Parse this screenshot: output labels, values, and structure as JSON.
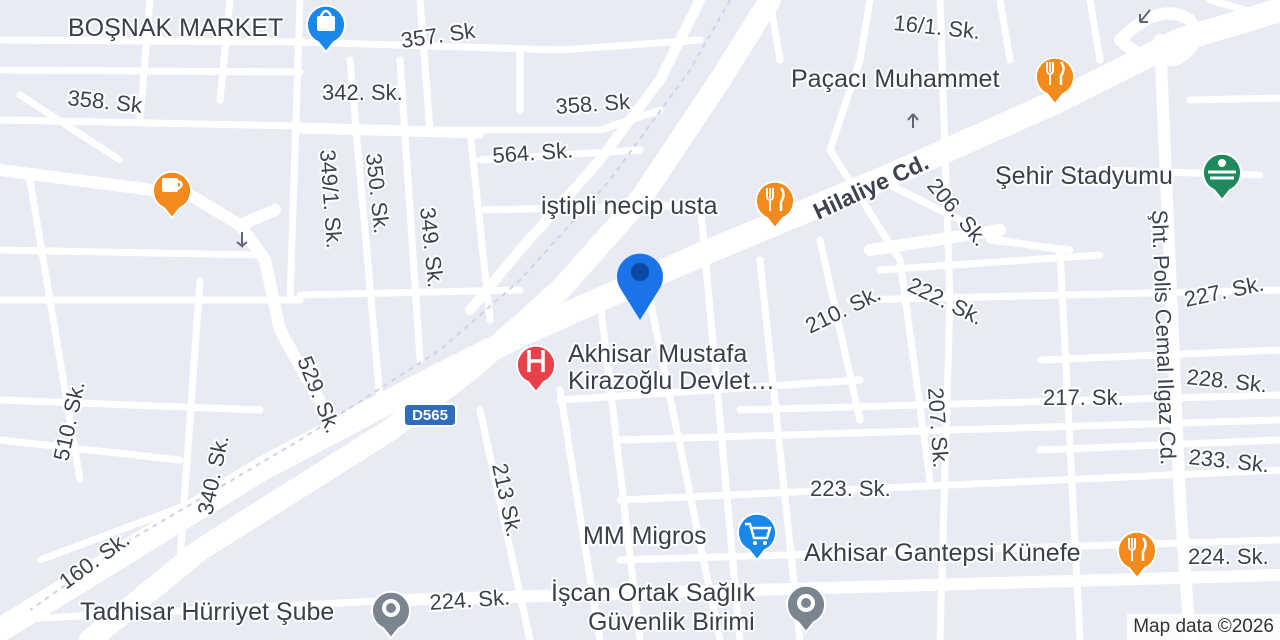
{
  "map": {
    "attribution": "Map data ©2026",
    "colors": {
      "land": "#e8ebf4",
      "road": "#ffffff",
      "marker": "#1a73e8",
      "food": "#f28a1e",
      "shop": "#1a88e8",
      "hospital": "#e9414c",
      "park": "#1e8a5c",
      "generic": "#7a8590"
    },
    "current_location_marker": {
      "icon": "location-pin-icon"
    },
    "highway_shield": {
      "label": "D565"
    },
    "streets": [
      {
        "id": "357",
        "label": "357. Sk"
      },
      {
        "id": "342",
        "label": "342. Sk."
      },
      {
        "id": "358a",
        "label": "358. Sk"
      },
      {
        "id": "358b",
        "label": "358. Sk"
      },
      {
        "id": "564",
        "label": "564. Sk."
      },
      {
        "id": "3491",
        "label": "349/1. Sk."
      },
      {
        "id": "350",
        "label": "350. Sk."
      },
      {
        "id": "349",
        "label": "349. Sk."
      },
      {
        "id": "529",
        "label": "529. Sk."
      },
      {
        "id": "510",
        "label": "510. Sk."
      },
      {
        "id": "340",
        "label": "340. Sk."
      },
      {
        "id": "160",
        "label": "160. Sk."
      },
      {
        "id": "213",
        "label": "213 Sk."
      },
      {
        "id": "hilaliye",
        "label": "Hilaliye Cd."
      },
      {
        "id": "161",
        "label": "16/1. Sk."
      },
      {
        "id": "206",
        "label": "206. Sk."
      },
      {
        "id": "210",
        "label": "210. Sk."
      },
      {
        "id": "222",
        "label": "222. Sk."
      },
      {
        "id": "227",
        "label": "227. Sk."
      },
      {
        "id": "217",
        "label": "217. Sk."
      },
      {
        "id": "228",
        "label": "228. Sk."
      },
      {
        "id": "207",
        "label": "207. Sk."
      },
      {
        "id": "233",
        "label": "233. Sk."
      },
      {
        "id": "223",
        "label": "223. Sk."
      },
      {
        "id": "224a",
        "label": "224. Sk."
      },
      {
        "id": "224b",
        "label": "224. Sk."
      },
      {
        "id": "polis",
        "label": "Şht. Polis Cemal Ilgaz Cd."
      }
    ],
    "pois": [
      {
        "id": "bosnak",
        "label": "BOŞNAK MARKET",
        "icon": "shopping-bag-icon",
        "category": "shop"
      },
      {
        "id": "cafe",
        "label": "",
        "icon": "coffee-cup-icon",
        "category": "food"
      },
      {
        "id": "pacaci",
        "label": "Paçacı Muhammet",
        "icon": "fork-knife-icon",
        "category": "food"
      },
      {
        "id": "istipli",
        "label": "iştipli necip usta",
        "icon": "fork-knife-icon",
        "category": "food"
      },
      {
        "id": "stadyum",
        "label": "Şehir Stadyumu",
        "icon": "stadium-icon",
        "category": "park"
      },
      {
        "id": "hospital",
        "label_line1": "Akhisar Mustafa",
        "label_line2": "Kirazoğlu Devlet…",
        "icon": "hospital-icon",
        "category": "hospital"
      },
      {
        "id": "migros",
        "label": "MM Migros",
        "icon": "shopping-cart-icon",
        "category": "shop"
      },
      {
        "id": "gantepsi",
        "label": "Akhisar Gantepsi Künefe",
        "icon": "fork-knife-icon",
        "category": "food"
      },
      {
        "id": "tadhisar",
        "label": "Tadhisar Hürriyet Şube",
        "icon": "generic-place-icon",
        "category": "generic"
      },
      {
        "id": "iscan",
        "label_line1": "İşcan Ortak Sağlık",
        "label_line2": "Güvenlik Birimi",
        "icon": "generic-place-icon",
        "category": "generic"
      }
    ]
  }
}
